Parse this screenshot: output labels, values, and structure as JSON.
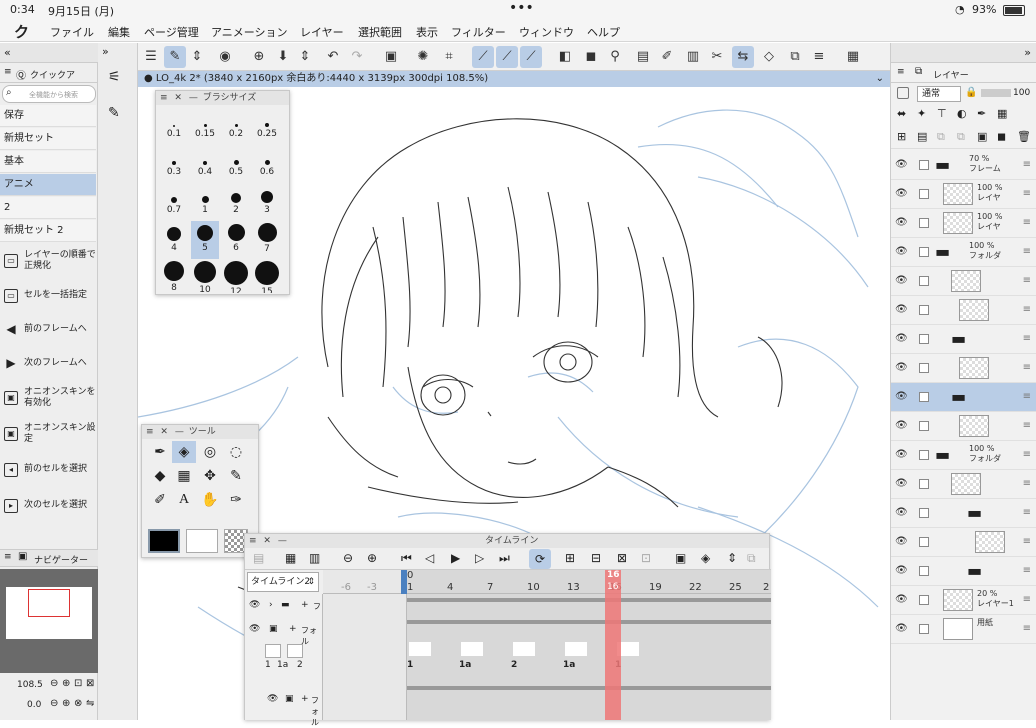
{
  "status": {
    "time": "0:34",
    "date": "9月15日 (月)",
    "battery": "93%"
  },
  "menu": {
    "logo": "ク",
    "items": [
      "ファイル",
      "編集",
      "ページ管理",
      "アニメーション",
      "レイヤー",
      "選択範囲",
      "表示",
      "フィルター",
      "ウィンドウ",
      "ヘルプ"
    ]
  },
  "document": {
    "tab_title": "● LO_4k 2* (3840 x 2160px 余白あり:4440 x 3139px 300dpi 108.5%)"
  },
  "quick_access": {
    "title": "クイックア",
    "search_placeholder": "全機能から検索",
    "sets": [
      "保存",
      "新規セット",
      "基本",
      "アニメ",
      "2",
      "新規セット 2"
    ],
    "selected_set": "アニメ",
    "actions": [
      {
        "icon": "layer-order-icon",
        "label": "レイヤーの順番で正規化"
      },
      {
        "icon": "cell-assign-icon",
        "label": "セルを一括指定"
      },
      {
        "icon": "prev-frame-icon",
        "label": "前のフレームへ"
      },
      {
        "icon": "next-frame-icon",
        "label": "次のフレームへ"
      },
      {
        "icon": "onion-skin-icon",
        "label": "オニオンスキンを有効化"
      },
      {
        "icon": "onion-settings-icon",
        "label": "オニオンスキン設定"
      },
      {
        "icon": "prev-cell-icon",
        "label": "前のセルを選択"
      },
      {
        "icon": "next-cell-icon",
        "label": "次のセルを選択"
      }
    ]
  },
  "navigator": {
    "title": "ナビゲーター",
    "zoom": "108.5",
    "angle": "0.0"
  },
  "brush_size": {
    "title": "ブラシサイズ",
    "sizes": [
      "0.1",
      "0.15",
      "0.2",
      "0.25",
      "0.3",
      "0.4",
      "0.5",
      "0.6",
      "0.7",
      "1",
      "2",
      "3",
      "4",
      "5",
      "6",
      "7",
      "8",
      "10",
      "12",
      "15"
    ],
    "selected": "5"
  },
  "tool_palette": {
    "title": "ツール",
    "main_color": "#000000",
    "sub_color": "#ffffff"
  },
  "layers": {
    "title": "レイヤー",
    "blend_mode": "通常",
    "opacity": "100",
    "rows": [
      {
        "pct": "70 %",
        "name": "フレーム",
        "type": "folder"
      },
      {
        "pct": "100 %",
        "name": "レイヤ",
        "type": "raster"
      },
      {
        "pct": "100 %",
        "name": "レイヤ",
        "type": "raster"
      },
      {
        "pct": "100 %",
        "name": "フォルダ",
        "type": "folder"
      },
      {
        "pct": "",
        "name": "",
        "type": "raster"
      },
      {
        "pct": "",
        "name": "",
        "type": "raster"
      },
      {
        "pct": "",
        "name": "",
        "type": "folder"
      },
      {
        "pct": "",
        "name": "",
        "type": "raster"
      },
      {
        "pct": "",
        "name": "",
        "type": "folder"
      },
      {
        "pct": "",
        "name": "",
        "type": "raster"
      },
      {
        "pct": "100 %",
        "name": "フォルダ",
        "type": "folder"
      },
      {
        "pct": "",
        "name": "",
        "type": "raster"
      },
      {
        "pct": "",
        "name": "",
        "type": "folder"
      },
      {
        "pct": "",
        "name": "",
        "type": "raster"
      },
      {
        "pct": "",
        "name": "",
        "type": "folder"
      },
      {
        "pct": "20 %",
        "name": "レイヤー1",
        "type": "raster"
      },
      {
        "pct": "",
        "name": "用紙",
        "type": "paper"
      }
    ]
  },
  "timeline": {
    "title": "タイムライン",
    "name": "タイムライン2",
    "frame_labels": [
      "-6",
      "-3",
      "0",
      "1",
      "4",
      "7",
      "10",
      "13",
      "16",
      "19",
      "22",
      "25",
      "2"
    ],
    "current_frame": "16",
    "cell_labels": [
      "1",
      "1a",
      "2",
      "1",
      "1a",
      "2",
      "1a",
      "1"
    ],
    "track_labels": [
      "フ",
      "フォル",
      "フォル"
    ]
  }
}
